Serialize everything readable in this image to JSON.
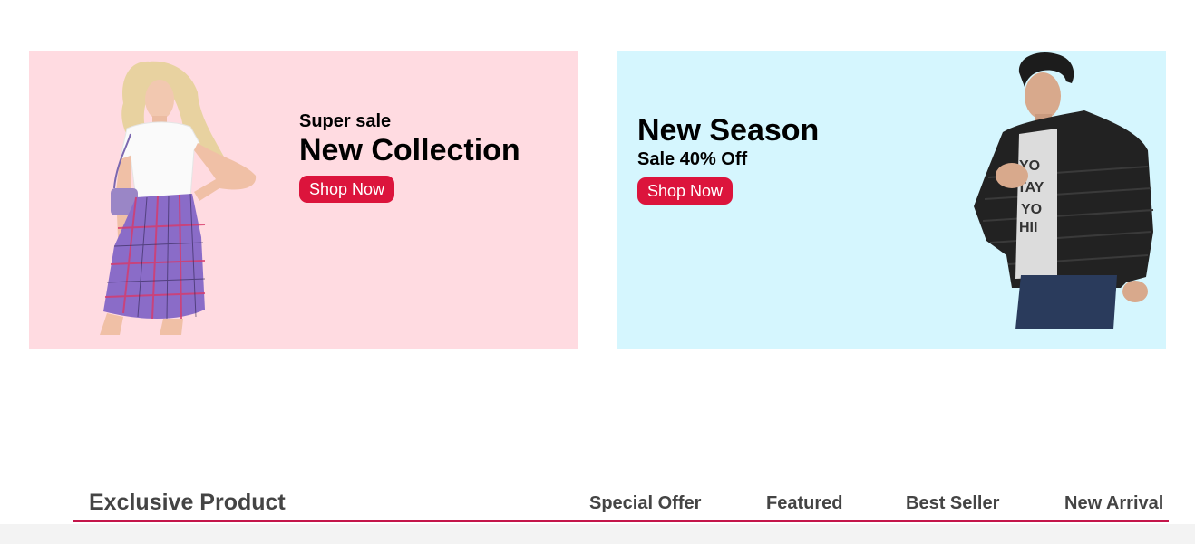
{
  "banners": {
    "left": {
      "kicker": "Super sale",
      "headline": "New Collection",
      "button_label": "Shop Now"
    },
    "right": {
      "headline": "New Season",
      "subline": "Sale 40% Off",
      "button_label": "Shop Now"
    }
  },
  "products": {
    "title": "Exclusive Product",
    "tabs": [
      {
        "label": "Special Offer"
      },
      {
        "label": "Featured"
      },
      {
        "label": "Best Seller"
      },
      {
        "label": "New Arrival"
      }
    ]
  },
  "colors": {
    "left_banner_bg": "#ffdbe1",
    "right_banner_bg": "#d5f6fe",
    "button_bg": "#dc143c",
    "tab_underline": "#c4164a"
  }
}
